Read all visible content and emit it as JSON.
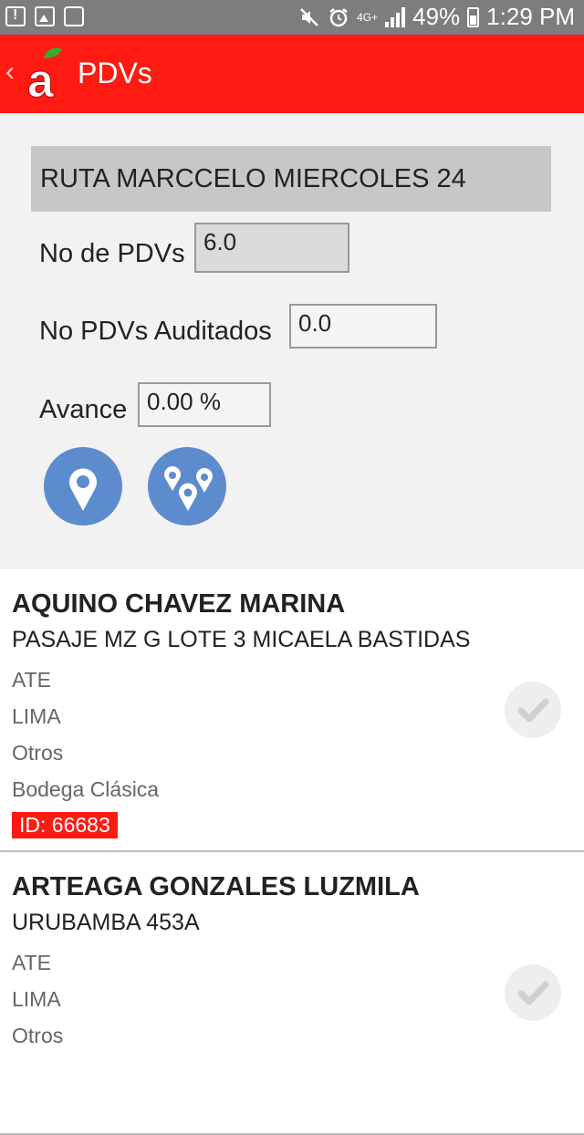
{
  "status_bar": {
    "network": "4G+",
    "battery": "49%",
    "time": "1:29 PM"
  },
  "app_bar": {
    "title": "PDVs",
    "logo_letter": "a",
    "colors": {
      "bar": "#ff1a12",
      "leaf": "#39a935"
    }
  },
  "summary": {
    "route_name": "RUTA MARCCELO MIERCOLES 24",
    "pdv_count_label": "No de PDVs",
    "pdv_count_value": "6.0",
    "audited_label": "No PDVs Auditados",
    "audited_value": "0.0",
    "progress_label": "Avance",
    "progress_value": "0.00 %",
    "buttons": [
      {
        "icon": "map-pin-icon"
      },
      {
        "icon": "multiple-map-pins-icon"
      }
    ]
  },
  "pdvs": [
    {
      "name": "AQUINO CHAVEZ MARINA",
      "address": "PASAJE MZ G LOTE 3 MICAELA BASTIDAS",
      "district": "ATE",
      "city": "LIMA",
      "category": "Otros",
      "type": "Bodega Clásica",
      "id": "ID: 66683"
    },
    {
      "name": "ARTEAGA GONZALES LUZMILA",
      "address": "URUBAMBA 453A",
      "district": "ATE",
      "city": "LIMA",
      "category": "Otros"
    }
  ]
}
